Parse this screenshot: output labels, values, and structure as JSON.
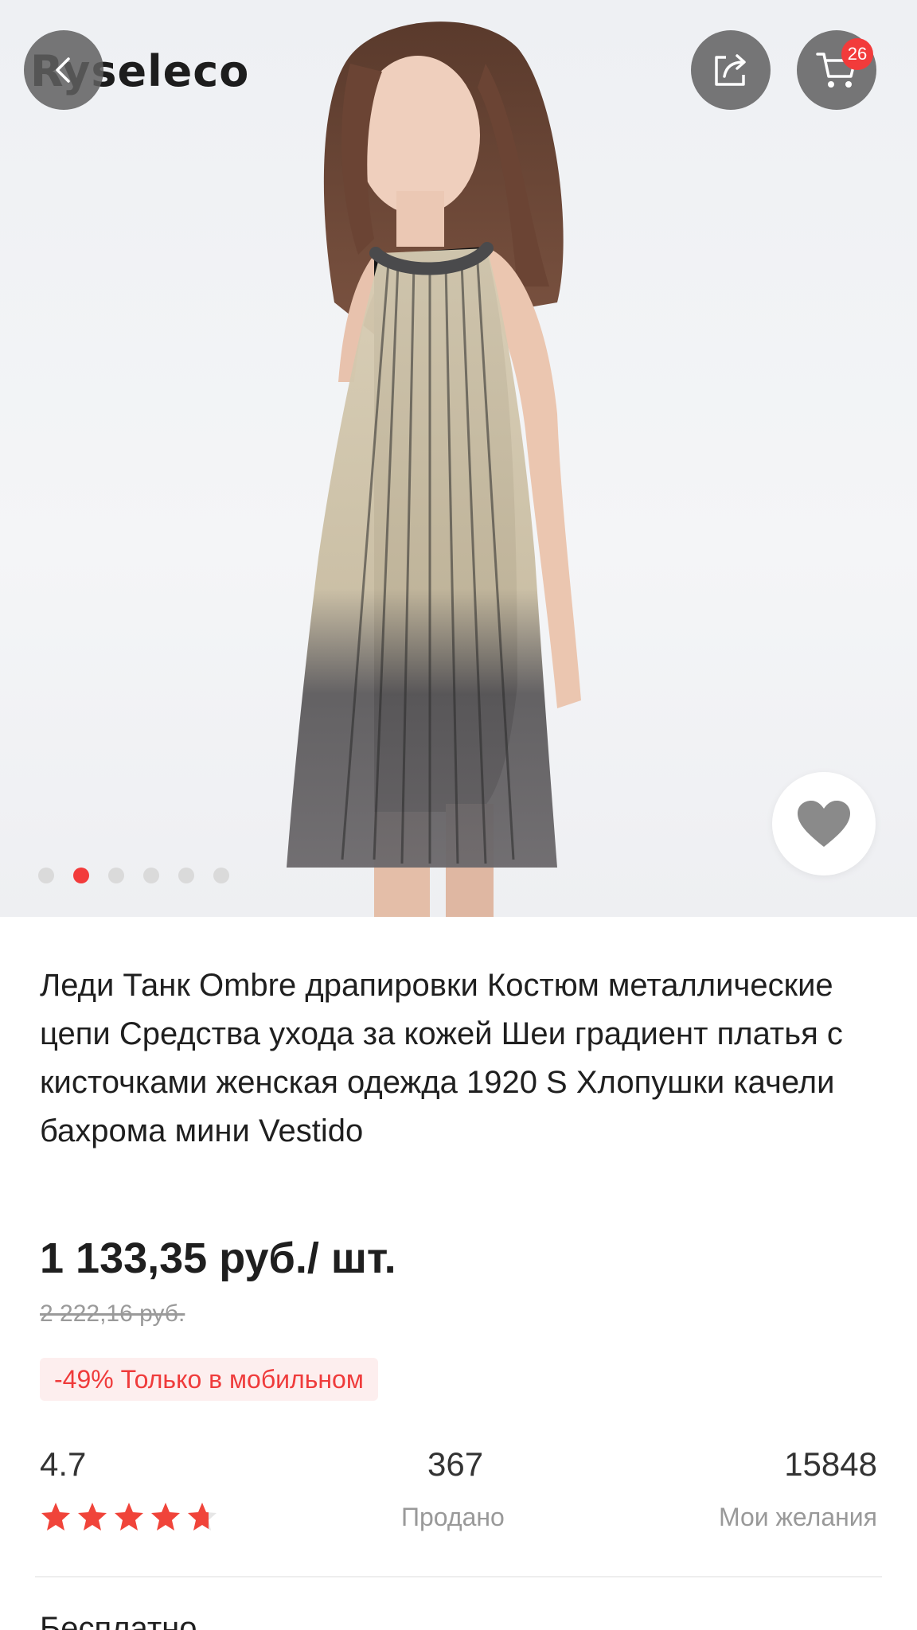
{
  "brand": {
    "name": "Ryseleco"
  },
  "header": {
    "back_icon": "chevron-left-icon",
    "share_icon": "share-icon",
    "cart_icon": "cart-icon",
    "cart_count": "26"
  },
  "gallery": {
    "total_images": 6,
    "active_index": 1,
    "favorite_icon": "heart-icon"
  },
  "product": {
    "title": "Леди Танк Ombre драпировки Костюм металлические цепи Средства ухода за кожей Шеи градиент платья с кисточками женская одежда 1920 S Хлопушки качели бахрома мини Vestido",
    "price": "1 133,35 руб./ шт.",
    "old_price": "2 222,16 руб.",
    "promo": "-49% Только в мобильном"
  },
  "stats": {
    "rating": "4.7",
    "rating_value": 4.7,
    "rating_max": 5,
    "sold": "367",
    "sold_label": "Продано",
    "wishes": "15848",
    "wishes_label": "Мои желания"
  },
  "next_section": {
    "label": "Бесплатно"
  },
  "colors": {
    "accent": "#f23b3b",
    "star": "#f0443a",
    "text": "#1f1f1f",
    "muted": "#999999"
  }
}
